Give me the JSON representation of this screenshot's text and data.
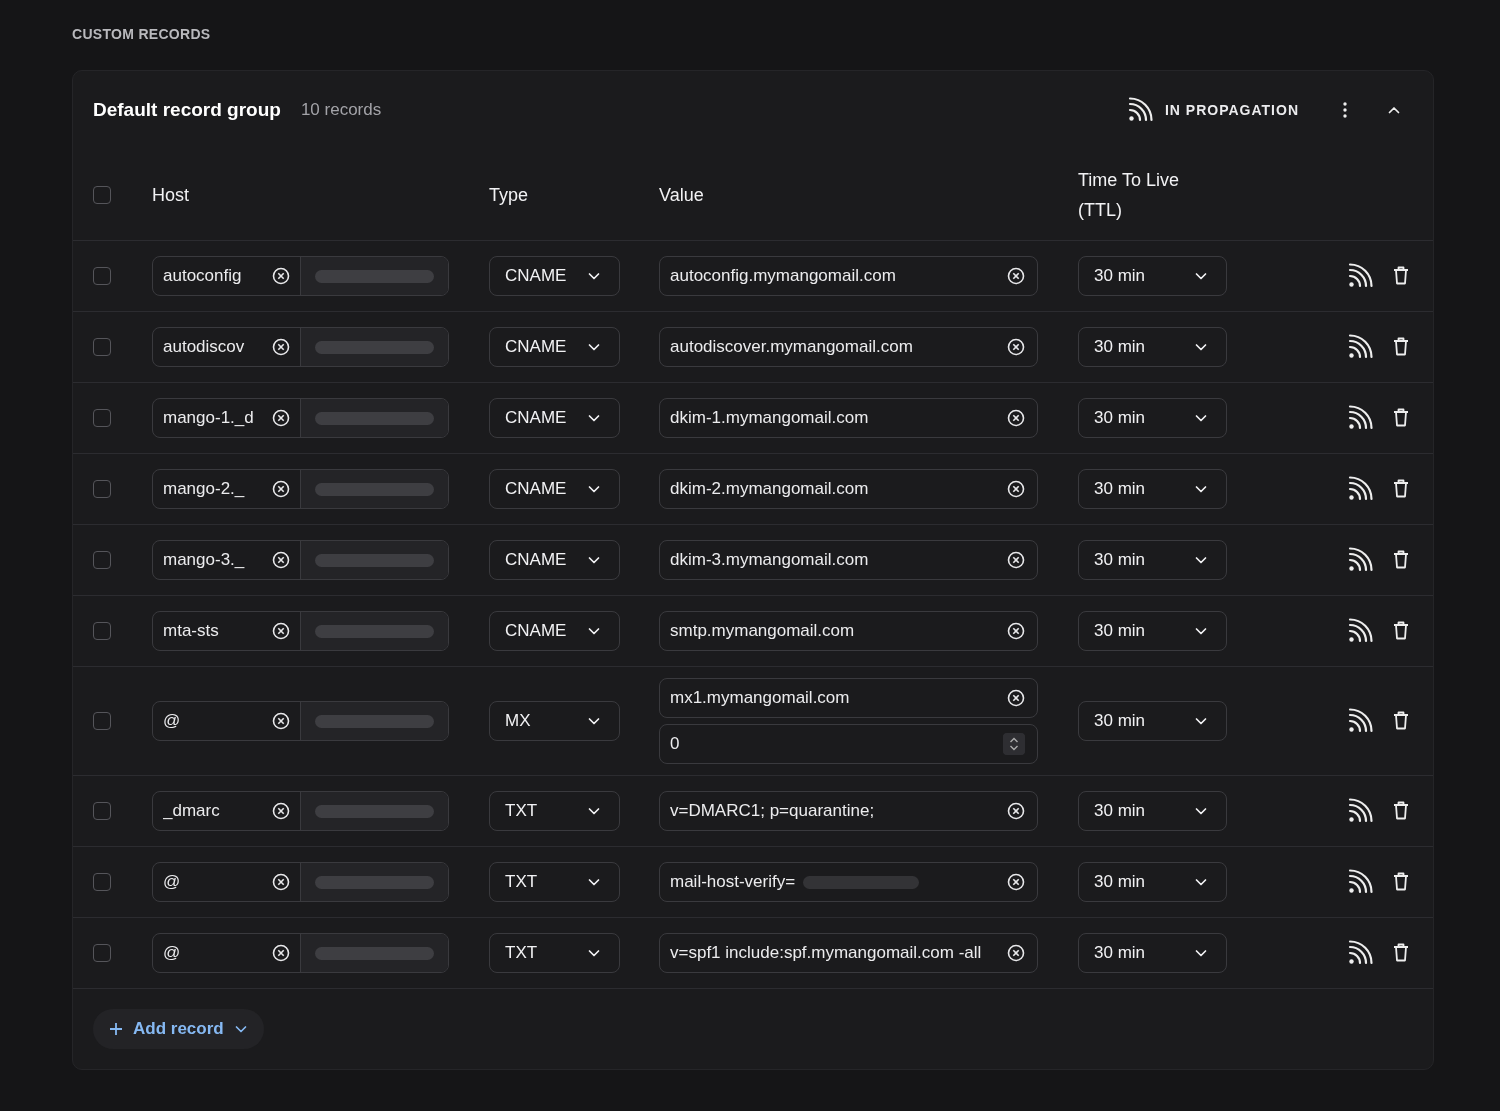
{
  "section_title": "CUSTOM RECORDS",
  "group": {
    "title": "Default record group",
    "count": "10 records",
    "status": "IN PROPAGATION",
    "expanded": true
  },
  "table": {
    "columns": [
      "Host",
      "Type",
      "Value",
      "Time To Live (TTL)"
    ],
    "all_checked": false,
    "rows": [
      {
        "checked": false,
        "host": "autoconfig",
        "type": "CNAME",
        "value": "autoconfig.mymangomail.com",
        "value_redacted": false,
        "ttl": "30 min"
      },
      {
        "checked": false,
        "host": "autodiscov",
        "type": "CNAME",
        "value": "autodiscover.mymangomail.com",
        "value_redacted": false,
        "ttl": "30 min"
      },
      {
        "checked": false,
        "host": "mango-1._d",
        "type": "CNAME",
        "value": "dkim-1.mymangomail.com",
        "value_redacted": false,
        "ttl": "30 min"
      },
      {
        "checked": false,
        "host": "mango-2._",
        "type": "CNAME",
        "value": "dkim-2.mymangomail.com",
        "value_redacted": false,
        "ttl": "30 min"
      },
      {
        "checked": false,
        "host": "mango-3._",
        "type": "CNAME",
        "value": "dkim-3.mymangomail.com",
        "value_redacted": false,
        "ttl": "30 min"
      },
      {
        "checked": false,
        "host": "mta-sts",
        "type": "CNAME",
        "value": "smtp.mymangomail.com",
        "value_redacted": false,
        "ttl": "30 min"
      },
      {
        "checked": false,
        "host": "@",
        "type": "MX",
        "value": "mx1.mymangomail.com",
        "value_redacted": false,
        "priority": "0",
        "ttl": "30 min"
      },
      {
        "checked": false,
        "host": "_dmarc",
        "type": "TXT",
        "value": "v=DMARC1; p=quarantine;",
        "value_redacted": false,
        "ttl": "30 min"
      },
      {
        "checked": false,
        "host": "@",
        "type": "TXT",
        "value": "mail-host-verify=",
        "value_redacted": true,
        "ttl": "30 min"
      },
      {
        "checked": false,
        "host": "@",
        "type": "TXT",
        "value": "v=spf1 include:spf.mymangomail.com -all",
        "value_redacted": false,
        "ttl": "30 min"
      }
    ]
  },
  "add_button": {
    "label": "Add record"
  }
}
